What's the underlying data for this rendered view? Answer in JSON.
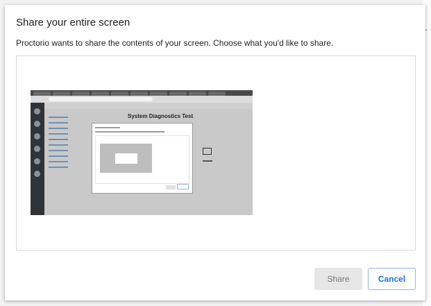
{
  "background": {
    "fragment_text": "r"
  },
  "dialog": {
    "title": "Share your entire screen",
    "subtitle": "Proctorio wants to share the contents of your screen. Choose what you'd like to share.",
    "preview": {
      "thumbnail_heading": "System Diagnostics Test"
    },
    "buttons": {
      "share_label": "Share",
      "cancel_label": "Cancel"
    }
  },
  "colors": {
    "accent": "#1a73e8",
    "cancel_border": "#8ab4f8",
    "share_disabled_bg": "#e6e6e6",
    "share_disabled_text": "#777777"
  }
}
